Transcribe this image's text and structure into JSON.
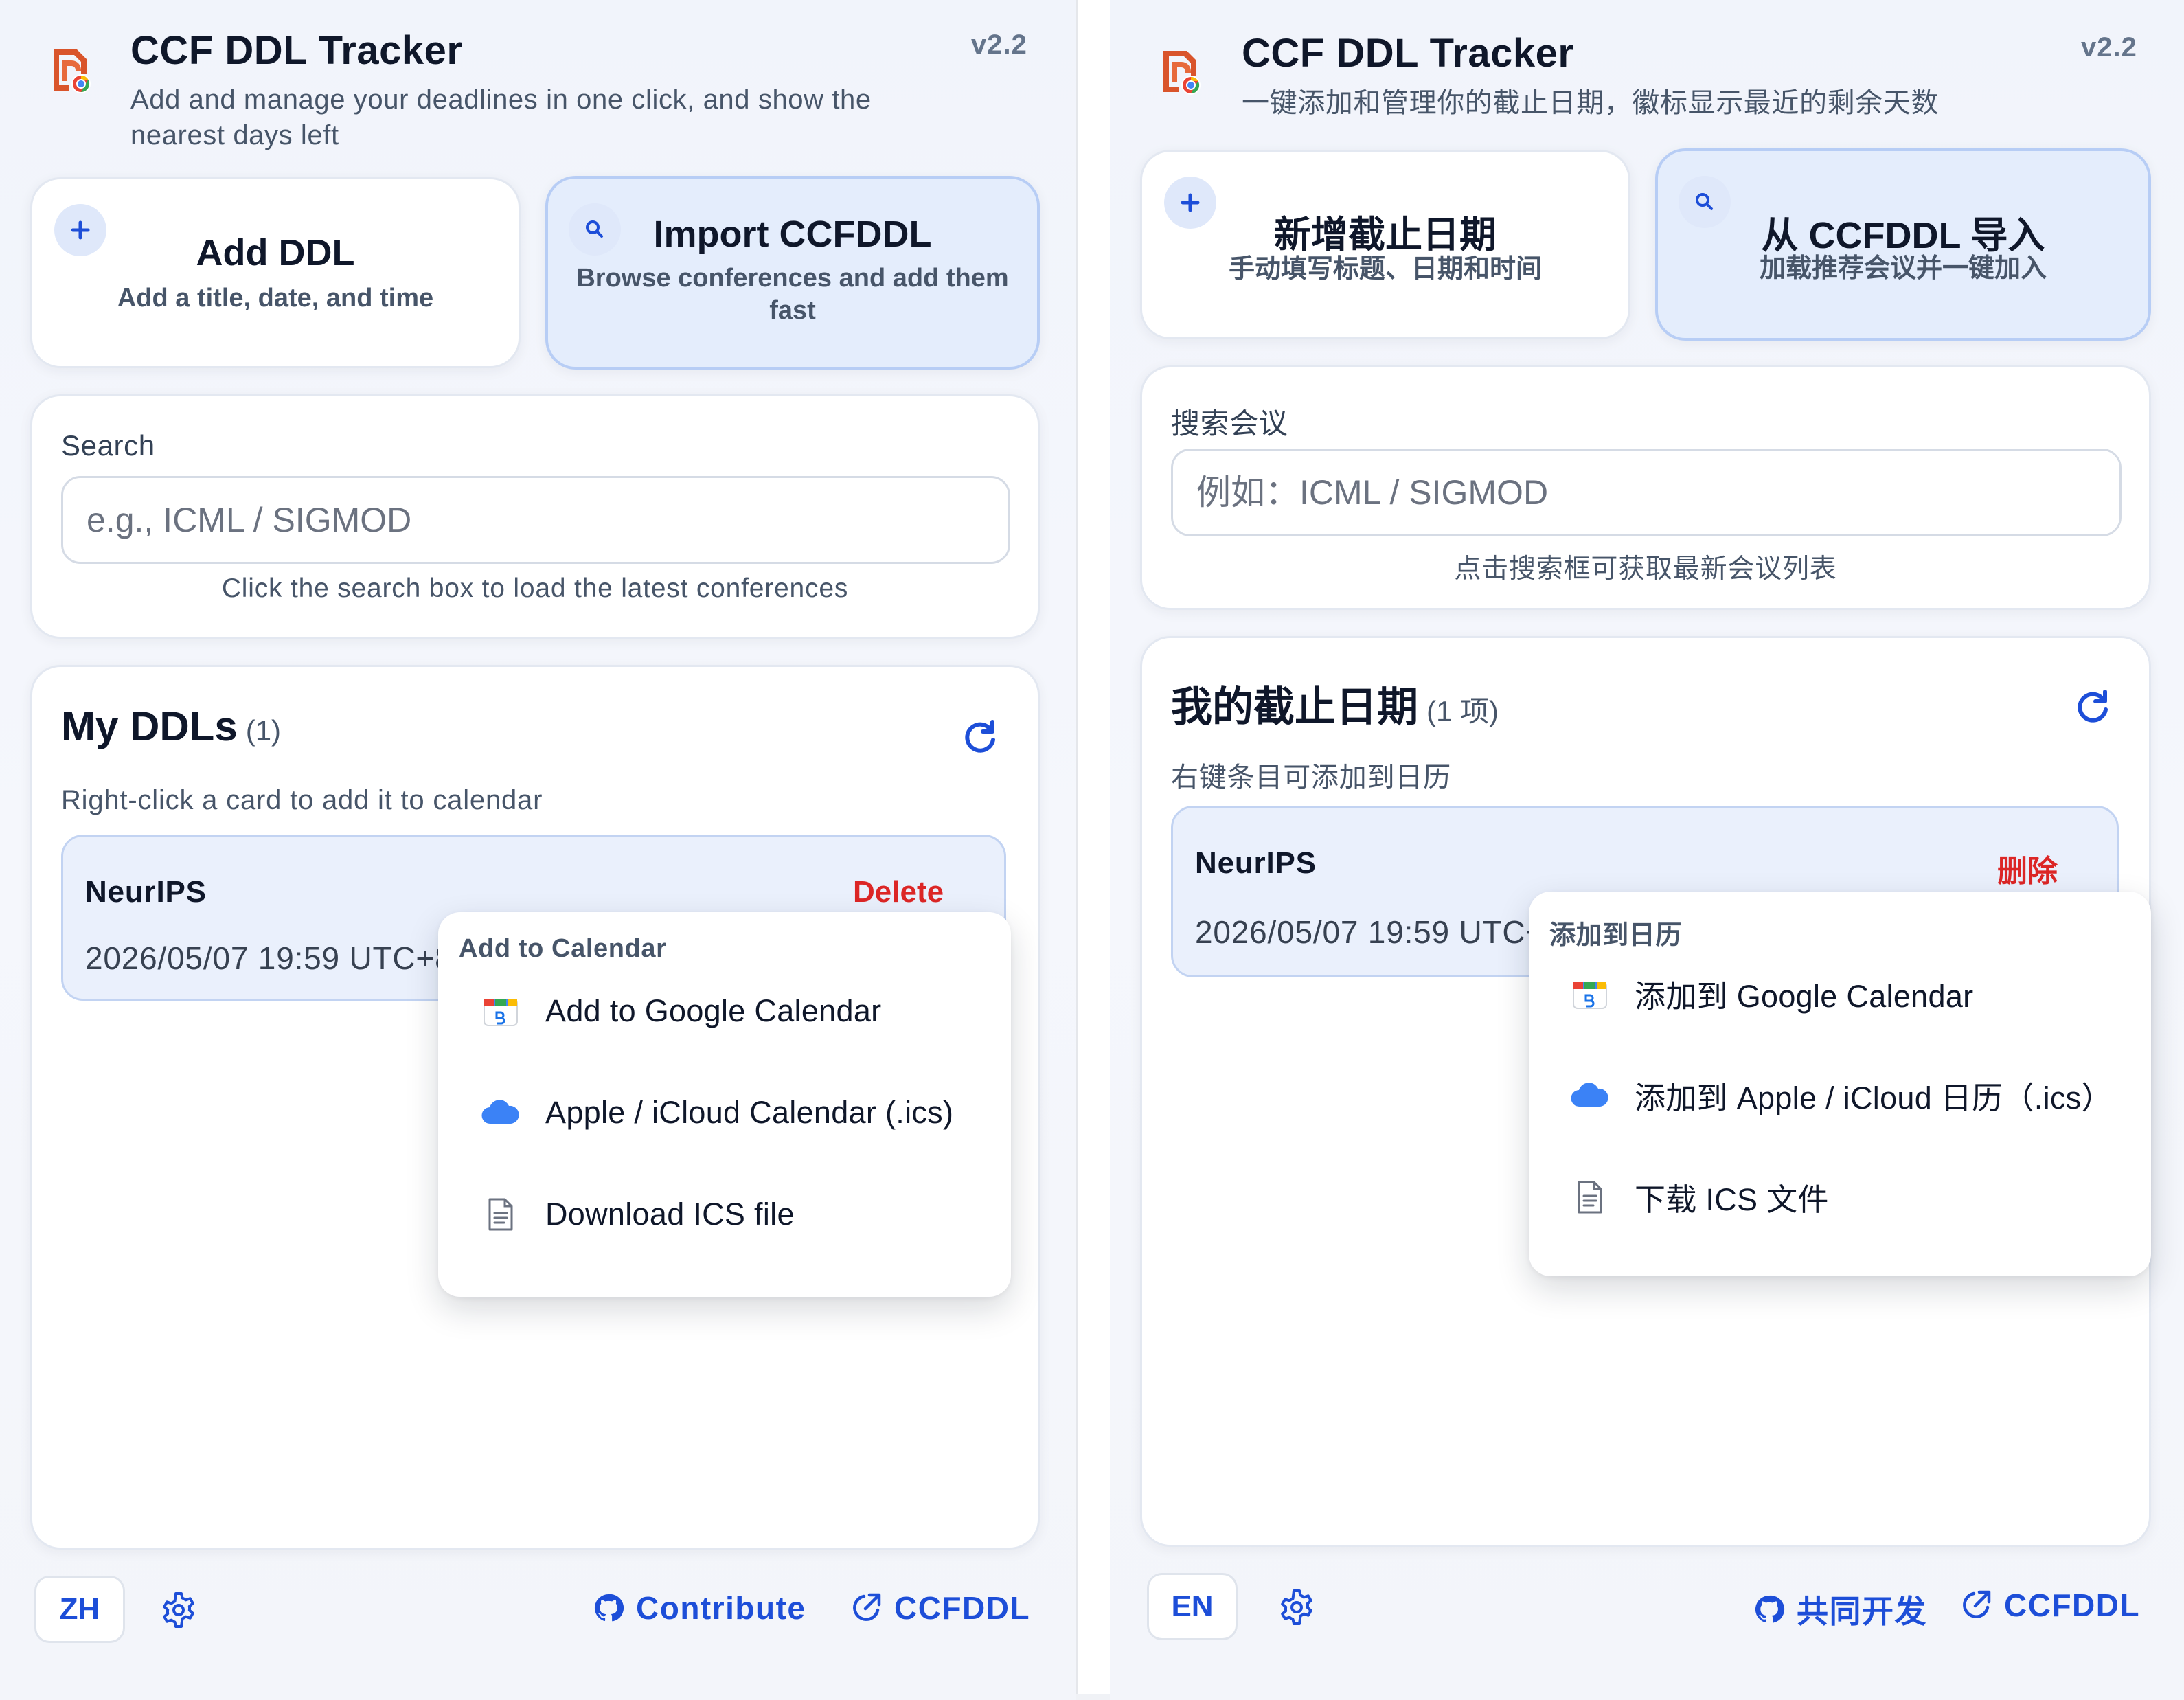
{
  "en": {
    "header": {
      "title": "CCF DDL Tracker",
      "subtitle": "Add and manage your deadlines in one click, and show the nearest days left",
      "version": "v2.2"
    },
    "actions": {
      "add": {
        "icon": "plus-icon",
        "title": "Add DDL",
        "desc": "Add a title, date, and time"
      },
      "import": {
        "icon": "search-icon",
        "title": "Import CCFDDL",
        "desc": "Browse conferences and add them fast"
      }
    },
    "search": {
      "label": "Search",
      "placeholder": "e.g., ICML / SIGMOD",
      "hint": "Click the search box to load the latest conferences"
    },
    "list": {
      "title": "My DDLs",
      "count": "(1)",
      "hint": "Right-click a card to add it to calendar"
    },
    "ddl": {
      "name": "NeurIPS",
      "date": "2026/05/07 19:59 UTC+8",
      "delete": "Delete"
    },
    "menu": {
      "header": "Add to Calendar",
      "items": [
        {
          "icon": "google-calendar-icon",
          "label": "Add to Google Calendar"
        },
        {
          "icon": "icloud-icon",
          "label": "Apple / iCloud Calendar (.ics)"
        },
        {
          "icon": "document-icon",
          "label": "Download ICS file"
        }
      ]
    },
    "footer": {
      "lang": "ZH",
      "contribute": "Contribute",
      "ccfddl": "CCFDDL"
    }
  },
  "zh": {
    "header": {
      "title": "CCF DDL Tracker",
      "subtitle": "一键添加和管理你的截止日期，徽标显示最近的剩余天数",
      "version": "v2.2"
    },
    "actions": {
      "add": {
        "icon": "plus-icon",
        "title": "新增截止日期",
        "desc": "手动填写标题、日期和时间"
      },
      "import": {
        "icon": "search-icon",
        "title": "从 CCFDDL 导入",
        "desc": "加载推荐会议并一键加入"
      }
    },
    "search": {
      "label": "搜索会议",
      "placeholder": "例如：ICML / SIGMOD",
      "hint": "点击搜索框可获取最新会议列表"
    },
    "list": {
      "title": "我的截止日期",
      "count": "(1 项)",
      "hint": "右键条目可添加到日历"
    },
    "ddl": {
      "name": "NeurIPS",
      "date": "2026/05/07 19:59 UTC+8",
      "delete": "删除"
    },
    "menu": {
      "header": "添加到日历",
      "items": [
        {
          "icon": "google-calendar-icon",
          "label": "添加到 Google Calendar"
        },
        {
          "icon": "icloud-icon",
          "label": "添加到 Apple / iCloud 日历（.ics）"
        },
        {
          "icon": "document-icon",
          "label": "下载 ICS 文件"
        }
      ]
    },
    "footer": {
      "lang": "EN",
      "contribute": "共同开发",
      "ccfddl": "CCFDDL"
    }
  },
  "colors": {
    "accent": "#1d4ed8",
    "danger": "#dc2626",
    "card_accent_bg": "#e4edfc"
  }
}
